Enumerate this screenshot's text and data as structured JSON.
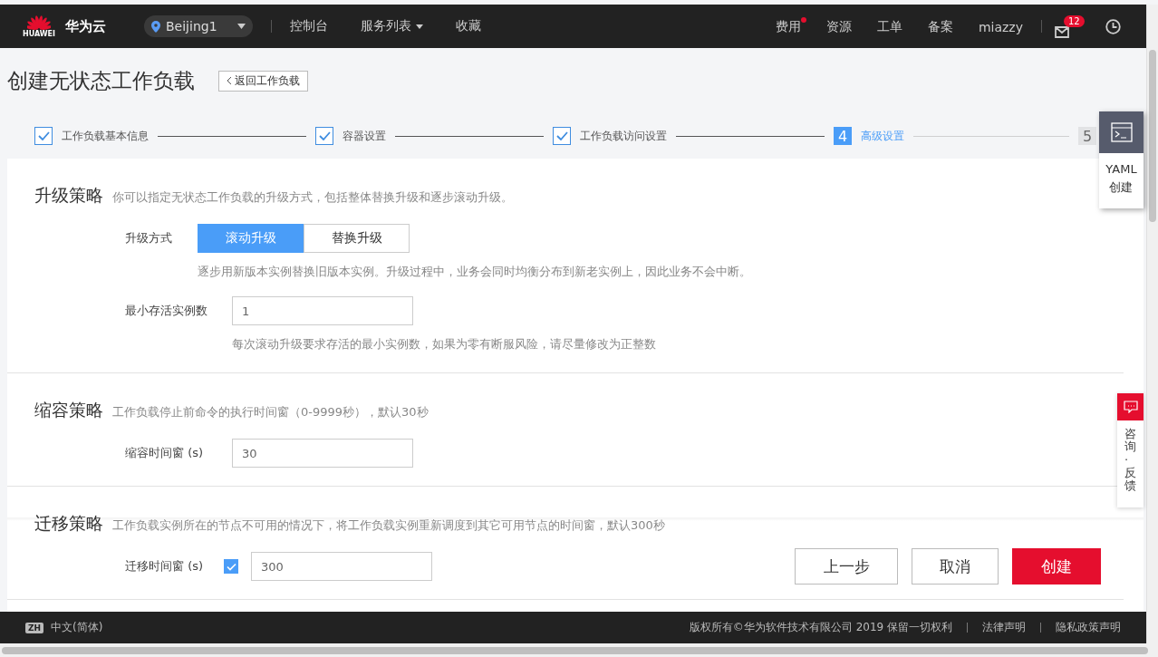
{
  "topbar": {
    "logo_text": "HUAWEI",
    "brand": "华为云",
    "region": "Beijing1",
    "nav": [
      {
        "label": "控制台",
        "kind": "link"
      },
      {
        "label": "服务列表",
        "kind": "dropdown"
      },
      {
        "label": "收藏",
        "kind": "link"
      }
    ],
    "right_nav": [
      {
        "label": "费用",
        "dot": true
      },
      {
        "label": "资源",
        "dot": false
      },
      {
        "label": "工单",
        "dot": false
      },
      {
        "label": "备案",
        "dot": false
      },
      {
        "label": "miazzy",
        "dot": false
      }
    ],
    "mail_badge": "12"
  },
  "page": {
    "title": "创建无状态工作负载",
    "back_button": "返回工作负载"
  },
  "steps": [
    {
      "label": "工作负载基本信息",
      "completed": true,
      "selected": false
    },
    {
      "label": "容器设置",
      "completed": true,
      "selected": false
    },
    {
      "label": "工作负载访问设置",
      "completed": true,
      "selected": false
    },
    {
      "number": "4",
      "label": "高级设置",
      "completed": false,
      "selected": true
    },
    {
      "number": "5",
      "completed": false,
      "selected": false
    }
  ],
  "sections": [
    {
      "title": "升级策略",
      "description": "你可以指定无状态工作负载的升级方式，包括整体替换升级和逐步滚动升级。",
      "fields": [
        {
          "kind": "segmented",
          "label": "升级方式",
          "options": [
            {
              "label": "滚动升级",
              "selected": true
            },
            {
              "label": "替换升级",
              "selected": false
            }
          ],
          "help": "逐步用新版本实例替换旧版本实例。升级过程中，业务会同时均衡分布到新老实例上，因此业务不会中断。"
        },
        {
          "kind": "input",
          "label": "最小存活实例数",
          "value": "1",
          "help": "每次滚动升级要求存活的最小实例数，如果为零有断服风险，请尽量修改为正整数"
        }
      ]
    },
    {
      "title": "缩容策略",
      "description": "工作负载停止前命令的执行时间窗（0-9999秒），默认30秒",
      "fields": [
        {
          "kind": "input",
          "label": "缩容时间窗 (s)",
          "value": "30"
        }
      ]
    },
    {
      "title": "迁移策略",
      "description": "工作负载实例所在的节点不可用的情况下，将工作负载实例重新调度到其它可用节点的时间窗，默认300秒",
      "fields": [
        {
          "kind": "checkbox_input",
          "label": "迁移时间窗 (s)",
          "checked": true,
          "value": "300"
        }
      ]
    }
  ],
  "actions": [
    {
      "label": "上一步",
      "kind": "secondary"
    },
    {
      "label": "取消",
      "kind": "secondary"
    },
    {
      "label": "创建",
      "kind": "primary"
    }
  ],
  "yaml_panel": {
    "lines": [
      "YAML",
      "创建"
    ]
  },
  "feedback": {
    "label": "咨询·反馈"
  },
  "footer": {
    "language_badge": "ZH",
    "language": "中文(简体)",
    "copyright": "版权所有©华为软件技术有限公司 2019 保留一切权利",
    "links": [
      "法律声明",
      "隐私政策声明"
    ]
  }
}
